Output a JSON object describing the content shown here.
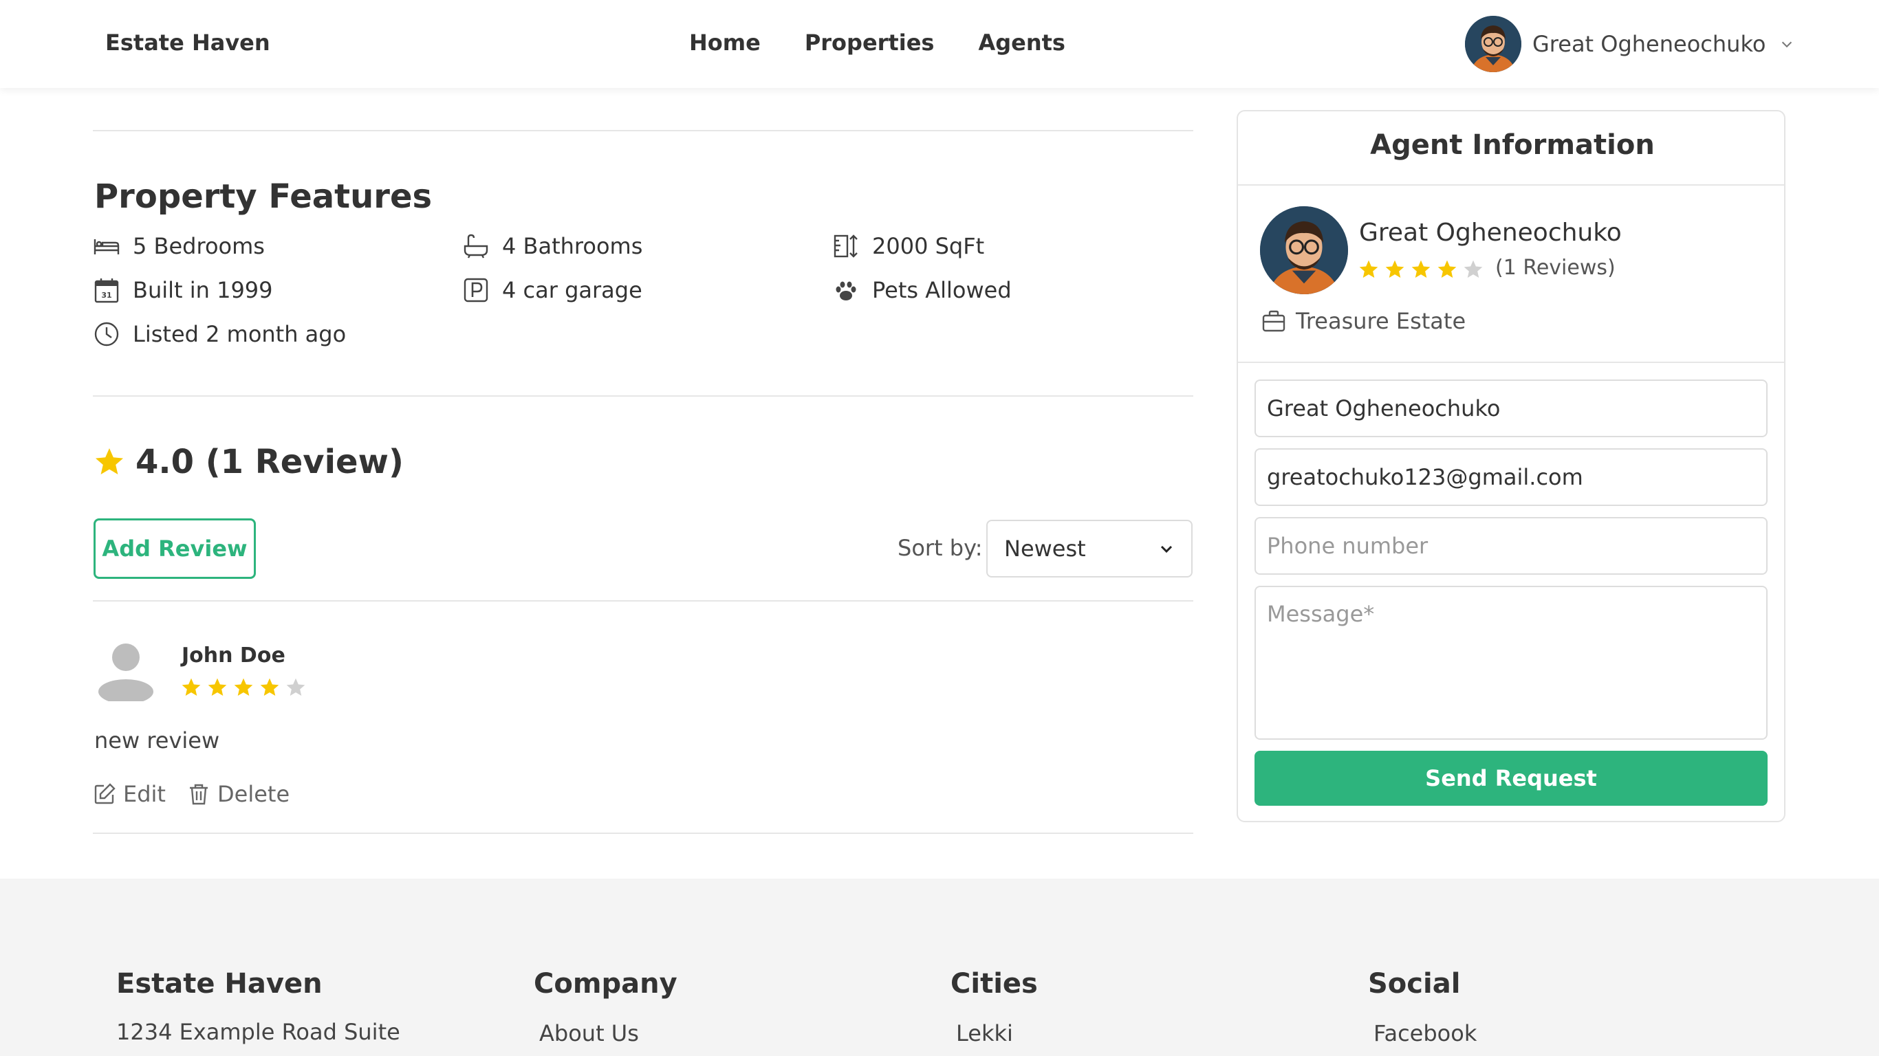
{
  "header": {
    "brand": "Estate Haven",
    "nav": [
      "Home",
      "Properties",
      "Agents"
    ],
    "user_name": "Great Ogheneochuko"
  },
  "features": {
    "title": "Property Features",
    "items": [
      {
        "icon": "bed-icon",
        "label": "5 Bedrooms"
      },
      {
        "icon": "bathtub-icon",
        "label": "4 Bathrooms"
      },
      {
        "icon": "area-icon",
        "label": "2000 SqFt"
      },
      {
        "icon": "calendar-icon",
        "label": "Built in 1999"
      },
      {
        "icon": "parking-icon",
        "label": "4 car garage"
      },
      {
        "icon": "paw-icon",
        "label": "Pets Allowed"
      },
      {
        "icon": "clock-icon",
        "label": "Listed 2 month ago"
      }
    ]
  },
  "reviews": {
    "summary": "4.0 (1 Review)",
    "add_label": "Add Review",
    "sort_label": "Sort by:",
    "sort_value": "Newest",
    "items": [
      {
        "name": "John Doe",
        "rating": 4,
        "text": "new review",
        "edit_label": "Edit",
        "delete_label": "Delete"
      }
    ]
  },
  "agent": {
    "title": "Agent Information",
    "name": "Great Ogheneochuko",
    "rating": 4,
    "reviews_text": "(1 Reviews)",
    "agency": "Treasure Estate",
    "form": {
      "name_value": "Great Ogheneochuko",
      "email_value": "greatochuko123@gmail.com",
      "phone_placeholder": "Phone number",
      "message_placeholder": "Message*",
      "submit_label": "Send Request"
    }
  },
  "footer": {
    "columns": [
      {
        "title": "Estate Haven",
        "item": "1234 Example Road Suite"
      },
      {
        "title": "Company",
        "item": "About Us"
      },
      {
        "title": "Cities",
        "item": "Lekki"
      },
      {
        "title": "Social",
        "item": "Facebook"
      }
    ]
  },
  "colors": {
    "accent": "#2db47d",
    "star": "#f7c600",
    "star_empty": "#d0d0d0",
    "footer_bg": "#f4f4f4"
  }
}
